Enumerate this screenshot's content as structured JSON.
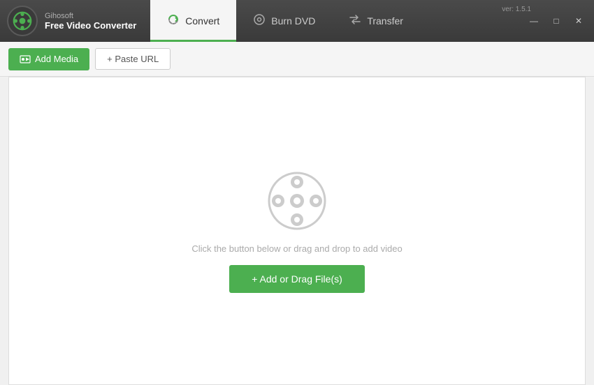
{
  "app": {
    "company": "Gihosoft",
    "name": "Free Video Converter",
    "version": "ver: 1.5.1"
  },
  "nav": {
    "tabs": [
      {
        "id": "convert",
        "label": "Convert",
        "active": true
      },
      {
        "id": "burn-dvd",
        "label": "Burn DVD",
        "active": false
      },
      {
        "id": "transfer",
        "label": "Transfer",
        "active": false
      }
    ]
  },
  "toolbar": {
    "add_media_label": "Add Media",
    "paste_url_label": "+ Paste URL"
  },
  "main": {
    "drop_hint": "Click the button below or drag and drop to add video",
    "add_drag_label": "+ Add or Drag File(s)"
  },
  "window_controls": {
    "minimize": "—",
    "maximize": "□",
    "close": "✕"
  },
  "colors": {
    "accent": "#4caf50",
    "titlebar": "#3d3d3d",
    "active_tab_bg": "#f5f5f5"
  }
}
